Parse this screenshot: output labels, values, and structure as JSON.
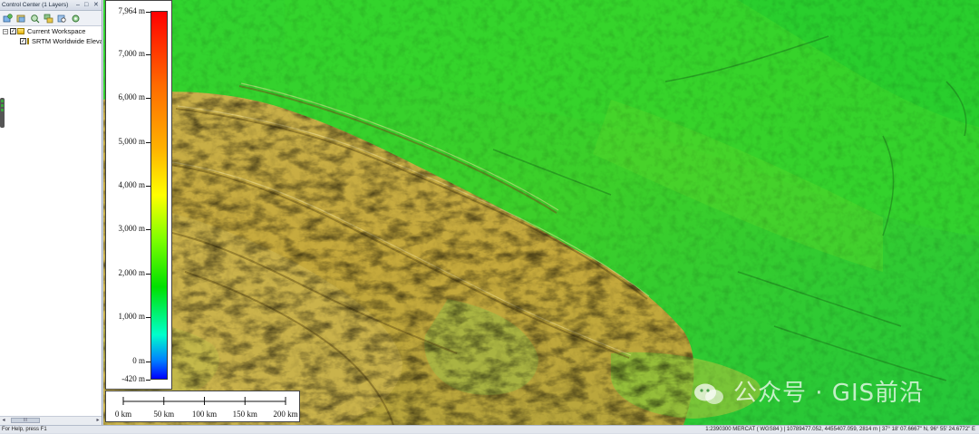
{
  "control_center": {
    "title": "Control Center (1 Layers)",
    "window_buttons": [
      "–",
      "□",
      "✕"
    ],
    "toolbar_icons": [
      "add-layer-icon",
      "layer-properties-icon",
      "zoom-to-layer-icon",
      "layer-group-icon",
      "find-layer-icon",
      "layer-settings-icon"
    ],
    "tree": {
      "workspace_label": "Current Workspace",
      "workspace_expander": "–",
      "layer_label": "SRTM Worldwide Elevation"
    }
  },
  "legend": {
    "labels": [
      {
        "text": "7,964 m",
        "value": 7964
      },
      {
        "text": "7,000 m",
        "value": 7000
      },
      {
        "text": "6,000 m",
        "value": 6000
      },
      {
        "text": "5,000 m",
        "value": 5000
      },
      {
        "text": "4,000 m",
        "value": 4000
      },
      {
        "text": "3,000 m",
        "value": 3000
      },
      {
        "text": "2,000 m",
        "value": 2000
      },
      {
        "text": "1,000 m",
        "value": 1000
      },
      {
        "text": "0 m",
        "value": 0
      },
      {
        "text": "-420 m",
        "value": -420
      }
    ],
    "colors": [
      "#ff0000",
      "#ff6a00",
      "#ffb000",
      "#ffff00",
      "#7fff00",
      "#00e000",
      "#00ffcc",
      "#0080ff",
      "#0000ff"
    ]
  },
  "scale_bar": {
    "labels": [
      "0 km",
      "50 km",
      "100 km",
      "150 km",
      "200 km"
    ]
  },
  "watermark": {
    "text": "公众号 · GIS前沿"
  },
  "status_bar": {
    "help": "For Help, press F1",
    "info": "1:2390300  MERCAT ( WGS84 ) | 10789477.052, 4455407.059, 2814 m | 37° 18' 07.6667\" N, 96° 55' 24.6772\" E"
  }
}
